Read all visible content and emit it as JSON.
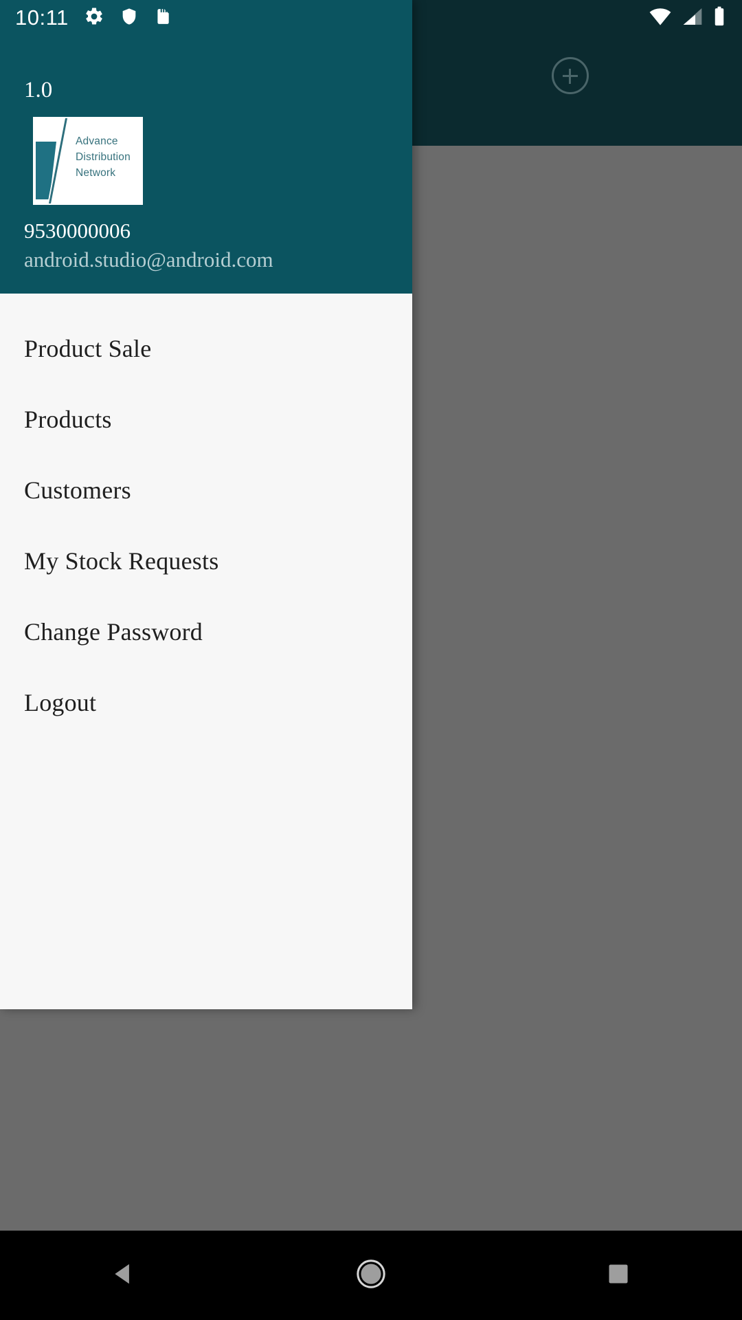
{
  "status_bar": {
    "time": "10:11",
    "left_icons": [
      "gear-icon",
      "shield-icon",
      "sd-card-icon"
    ],
    "right_icons": [
      "wifi-icon",
      "cell-signal-icon",
      "battery-icon"
    ]
  },
  "app_bar": {
    "action_icon": "add-circle-icon"
  },
  "drawer": {
    "version": "1.0",
    "logo": {
      "line1": "Advance",
      "line2": "Distribution",
      "line3": "Network"
    },
    "phone": "9530000006",
    "email": "android.studio@android.com",
    "menu_items": [
      {
        "label": "Product Sale",
        "name": "product-sale"
      },
      {
        "label": "Products",
        "name": "products"
      },
      {
        "label": "Customers",
        "name": "customers"
      },
      {
        "label": "My Stock Requests",
        "name": "my-stock-requests"
      },
      {
        "label": "Change Password",
        "name": "change-password"
      },
      {
        "label": "Logout",
        "name": "logout"
      }
    ]
  },
  "nav_bar": {
    "back": "back-triangle-icon",
    "home": "home-circle-icon",
    "recents": "recents-square-icon"
  },
  "colors": {
    "drawer_header": "#0b5460",
    "app_bar": "#0b2a2f",
    "scrim": "#6b6b6b",
    "drawer_bg": "#f7f7f7",
    "logo_teal": "#37727d"
  }
}
